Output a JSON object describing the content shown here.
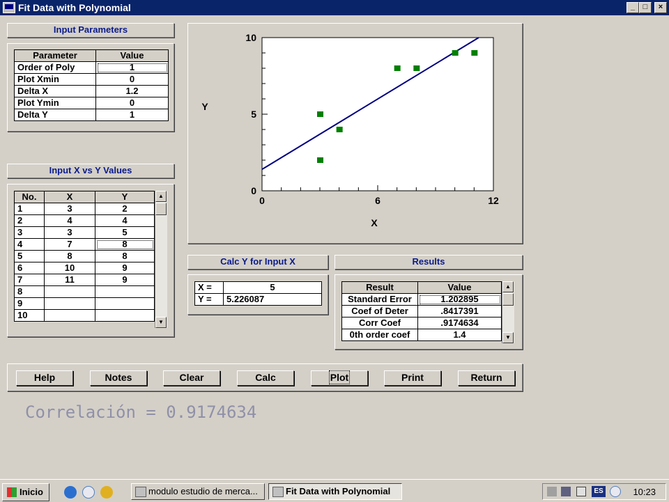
{
  "window": {
    "title": "Fit Data with Polynomial",
    "controls": [
      "_",
      "□",
      "×"
    ]
  },
  "input_params": {
    "header": "Input Parameters",
    "col_param": "Parameter",
    "col_value": "Value",
    "rows": [
      {
        "label": "Order of Poly",
        "value": "1"
      },
      {
        "label": "Plot Xmin",
        "value": "0"
      },
      {
        "label": "Delta X",
        "value": "1.2"
      },
      {
        "label": "Plot Ymin",
        "value": "0"
      },
      {
        "label": "Delta Y",
        "value": "1"
      }
    ]
  },
  "xy_values": {
    "header": "Input X vs Y Values",
    "col_no": "No.",
    "col_x": "X",
    "col_y": "Y",
    "rows": [
      {
        "no": "1",
        "x": "3",
        "y": "2"
      },
      {
        "no": "2",
        "x": "4",
        "y": "4"
      },
      {
        "no": "3",
        "x": "3",
        "y": "5"
      },
      {
        "no": "4",
        "x": "7",
        "y": "8"
      },
      {
        "no": "5",
        "x": "8",
        "y": "8"
      },
      {
        "no": "6",
        "x": "10",
        "y": "9"
      },
      {
        "no": "7",
        "x": "11",
        "y": "9"
      },
      {
        "no": "8",
        "x": "",
        "y": ""
      },
      {
        "no": "9",
        "x": "",
        "y": ""
      },
      {
        "no": "10",
        "x": "",
        "y": ""
      }
    ]
  },
  "calc": {
    "header": "Calc Y for Input X",
    "x_label": "X =",
    "x_value": "5",
    "y_label": "Y =",
    "y_value": "5.226087"
  },
  "results": {
    "header": "Results",
    "col_result": "Result",
    "col_value": "Value",
    "rows": [
      {
        "label": "Standard Error",
        "value": "1.202895"
      },
      {
        "label": "Coef of Deter",
        "value": ".8417391"
      },
      {
        "label": "Corr Coef",
        "value": ".9174634"
      },
      {
        "label": "0th order coef",
        "value": "1.4"
      }
    ]
  },
  "buttons": {
    "help": "Help",
    "notes": "Notes",
    "clear": "Clear",
    "calc": "Calc",
    "plot": "Plot",
    "print": "Print",
    "return": "Return"
  },
  "caption": "Correlación = 0.9174634",
  "chart_data": {
    "type": "scatter",
    "xlabel": "X",
    "ylabel": "Y",
    "xlim": [
      0,
      12
    ],
    "ylim": [
      0,
      10
    ],
    "xticks": [
      "0",
      "6",
      "12"
    ],
    "yticks": [
      "0",
      "5",
      "10"
    ],
    "x": [
      3,
      4,
      3,
      7,
      8,
      10,
      11
    ],
    "y": [
      2,
      4,
      5,
      8,
      8,
      9,
      9
    ],
    "fit_line": {
      "intercept": 1.4,
      "slope": 0.765217
    },
    "point_color": "#008000",
    "line_color": "#000080",
    "grid": false
  },
  "taskbar": {
    "start": "Inicio",
    "tasks": [
      {
        "label": "modulo estudio de merca...",
        "active": false
      },
      {
        "label": "Fit Data with Polynomial",
        "active": true
      }
    ],
    "lang": "ES",
    "clock": "10:23"
  }
}
